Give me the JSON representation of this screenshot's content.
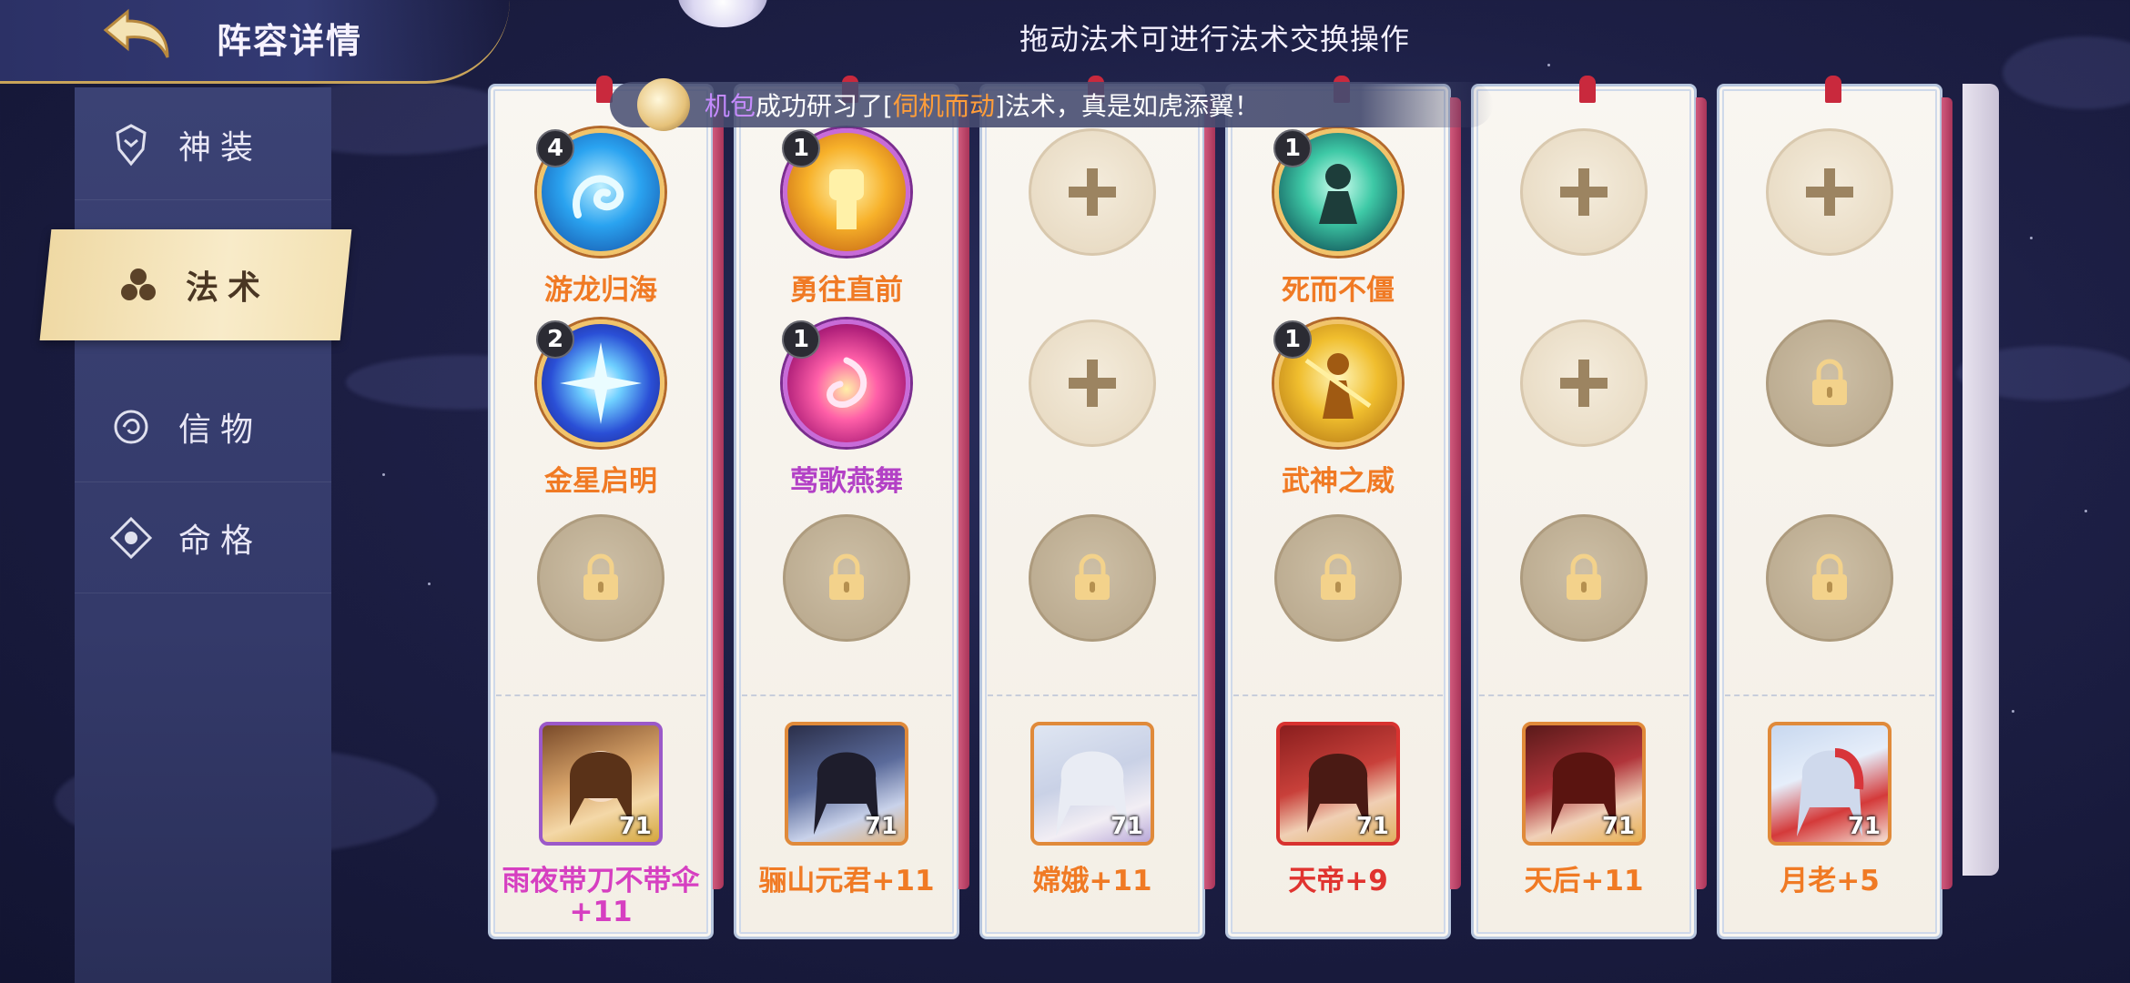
{
  "header": {
    "title": "阵容详情",
    "hint": "拖动法术可进行法术交换操作"
  },
  "notice": {
    "prefix": "机包",
    "middle": "成功研习了[",
    "skill": "伺机而动",
    "suffix": "]法术，真是如虎添翼！"
  },
  "sidebar": {
    "items": [
      {
        "label": "神装",
        "icon": "armor-icon",
        "active": false
      },
      {
        "label": "法术",
        "icon": "magic-icon",
        "active": true
      },
      {
        "label": "信物",
        "icon": "token-icon",
        "active": false
      },
      {
        "label": "命格",
        "icon": "fate-icon",
        "active": false
      }
    ]
  },
  "colors": {
    "accent_gold": "#f1c46b",
    "skill_orange": "#f07a24",
    "skill_purple": "#b341c6",
    "name_pink": "#d63fc1",
    "name_red": "#e0332f"
  },
  "cards": [
    {
      "slots": [
        {
          "type": "skill",
          "name": "游龙归海",
          "count": "4",
          "color": "orange",
          "icon": "dragon-skill-icon"
        },
        {
          "type": "skill",
          "name": "金星启明",
          "count": "2",
          "color": "orange",
          "icon": "star-skill-icon"
        },
        {
          "type": "locked"
        }
      ],
      "hero": {
        "name": "雨夜带刀不带伞+11",
        "level": "71",
        "frame": "#9b59c9",
        "name_color": "#d63fc1"
      }
    },
    {
      "slots": [
        {
          "type": "skill",
          "name": "勇往直前",
          "count": "1",
          "color": "orange",
          "icon": "fist-skill-icon"
        },
        {
          "type": "skill",
          "name": "莺歌燕舞",
          "count": "1",
          "color": "purple",
          "icon": "dance-skill-icon"
        },
        {
          "type": "locked"
        }
      ],
      "hero": {
        "name": "骊山元君+11",
        "level": "71",
        "frame": "#e08a3a",
        "name_color": "#f07a24"
      }
    },
    {
      "slots": [
        {
          "type": "empty"
        },
        {
          "type": "empty"
        },
        {
          "type": "locked"
        }
      ],
      "hero": {
        "name": "嫦娥+11",
        "level": "71",
        "frame": "#e08a3a",
        "name_color": "#f07a24"
      }
    },
    {
      "slots": [
        {
          "type": "skill",
          "name": "死而不僵",
          "count": "1",
          "color": "orange",
          "icon": "undead-skill-icon"
        },
        {
          "type": "skill",
          "name": "武神之威",
          "count": "1",
          "color": "orange",
          "icon": "wargod-skill-icon"
        },
        {
          "type": "locked"
        }
      ],
      "hero": {
        "name": "天帝+9",
        "level": "71",
        "frame": "#d8322f",
        "name_color": "#e0332f"
      }
    },
    {
      "slots": [
        {
          "type": "empty"
        },
        {
          "type": "empty"
        },
        {
          "type": "locked"
        }
      ],
      "hero": {
        "name": "天后+11",
        "level": "71",
        "frame": "#e08a3a",
        "name_color": "#f07a24"
      }
    },
    {
      "slots": [
        {
          "type": "empty"
        },
        {
          "type": "locked"
        },
        {
          "type": "locked"
        }
      ],
      "hero": {
        "name": "月老+5",
        "level": "71",
        "frame": "#e08a3a",
        "name_color": "#f07a24"
      }
    }
  ]
}
